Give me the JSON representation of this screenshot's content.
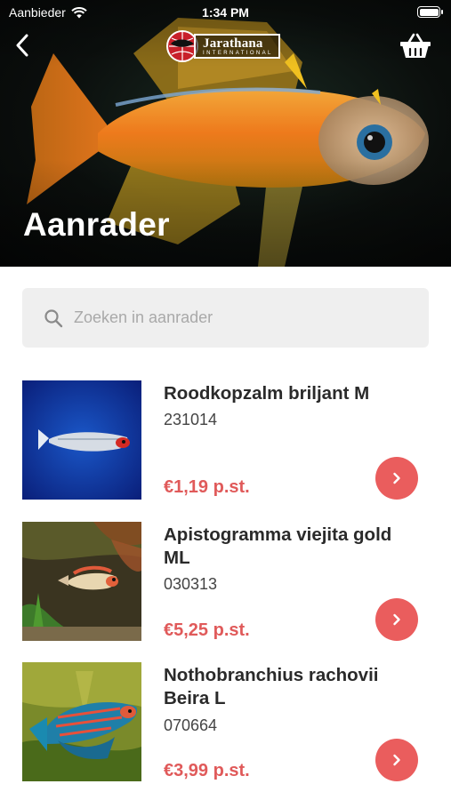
{
  "status_bar": {
    "carrier": "Aanbieder",
    "time": "1:34 PM"
  },
  "header": {
    "logo_name": "Jarathana",
    "logo_sub": "INTERNATIONAL",
    "title": "Aanrader",
    "back_icon": "chevron-left-icon",
    "cart_icon": "basket-icon"
  },
  "search": {
    "placeholder": "Zoeken in aanrader",
    "value": "",
    "icon": "search-icon"
  },
  "products": [
    {
      "name": "Roodkopzalm briljant M",
      "code": "231014",
      "price": "€1,19 p.st."
    },
    {
      "name": "Apistogramma viejita gold ML",
      "code": "030313",
      "price": "€5,25 p.st."
    },
    {
      "name": "Nothobranchius rachovii Beira L",
      "code": "070664",
      "price": "€3,99 p.st."
    }
  ],
  "colors": {
    "accent": "#ea5d5d",
    "price": "#e05a5a",
    "search_bg": "#efefef"
  }
}
